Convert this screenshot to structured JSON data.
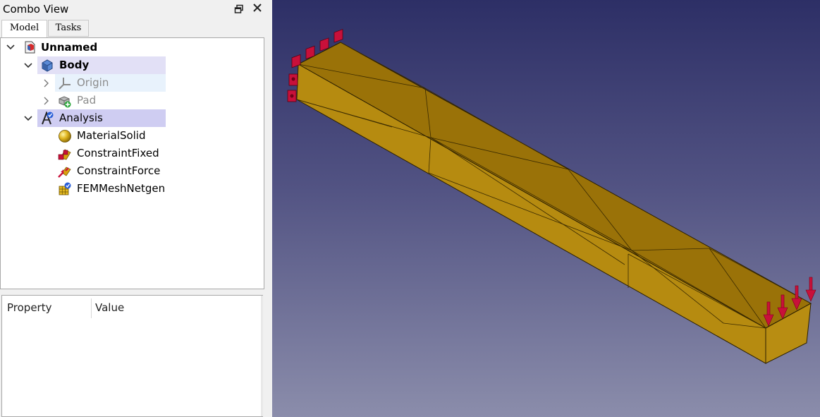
{
  "combo_view": {
    "title": "Combo View",
    "float_icon": "float-window-icon",
    "close_icon": "close-icon",
    "tabs": [
      {
        "label": "Model",
        "active": true
      },
      {
        "label": "Tasks",
        "active": false
      }
    ]
  },
  "tree": {
    "items": [
      {
        "label": "Unnamed",
        "icon": "document-icon",
        "expanded": true,
        "bold": true
      },
      {
        "label": "Body",
        "icon": "body-icon",
        "expanded": true,
        "bold": false
      },
      {
        "label": "Origin",
        "icon": "origin-icon",
        "expanded": false,
        "disabled": true
      },
      {
        "label": "Pad",
        "icon": "pad-icon",
        "expanded": false,
        "disabled": true
      },
      {
        "label": "Analysis",
        "icon": "analysis-icon",
        "expanded": true
      },
      {
        "label": "MaterialSolid",
        "icon": "material-icon"
      },
      {
        "label": "ConstraintFixed",
        "icon": "constraint-fixed-icon"
      },
      {
        "label": "ConstraintForce",
        "icon": "constraint-force-icon"
      },
      {
        "label": "FEMMeshNetgen",
        "icon": "fem-mesh-icon"
      }
    ]
  },
  "properties": {
    "columns": [
      "Property",
      "Value"
    ]
  },
  "viewport": {
    "background_top": "#2d2f66",
    "background_bottom": "#8b8dab",
    "solid_color": "#b58810",
    "fixed_marker_color": "#c8103a",
    "force_arrow_color": "#c8103a"
  }
}
